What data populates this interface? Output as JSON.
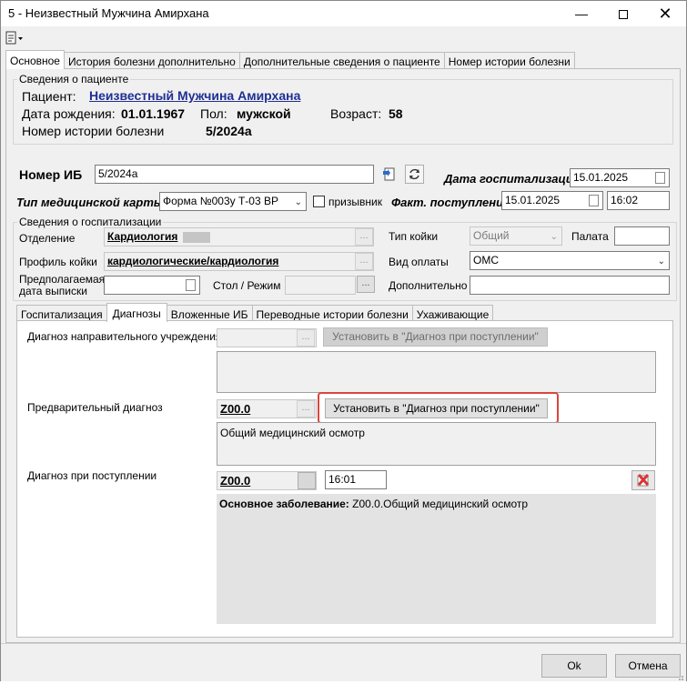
{
  "window": {
    "title": "5 - Неизвестный Мужчина Амирхана"
  },
  "top_tabs": [
    {
      "label": "Основное",
      "active": true
    },
    {
      "label": "История болезни дополнительно",
      "active": false
    },
    {
      "label": "Дополнительные сведения о пациенте",
      "active": false
    },
    {
      "label": "Номер истории болезни",
      "active": false
    }
  ],
  "patient": {
    "group_title": "Сведения о пациенте",
    "patient_label": "Пациент:",
    "patient_name": "Неизвестный Мужчина Амирхана",
    "birth_label": "Дата рождения:",
    "birth_value": "01.01.1967",
    "sex_label": "Пол:",
    "sex_value": "мужской",
    "age_label": "Возраст:",
    "age_value": "58",
    "history_label": "Номер истории болезни",
    "history_value": "5/2024а"
  },
  "ib": {
    "label": "Номер ИБ",
    "value": "5/2024а",
    "hosp_date_label": "Дата госпитализации",
    "hosp_date_value": "15.01.2025",
    "card_type_label": "Тип медицинской карты",
    "card_type_value": "Форма №003у Т-03 ВР",
    "conscript_label": "призывник",
    "admission_label": "Факт. поступление",
    "admission_date": "15.01.2025",
    "admission_time": "16:02"
  },
  "hosp": {
    "group_title": "Сведения о госпитализации",
    "dept_label": "Отделение",
    "dept_value": "Кардиология",
    "bed_type_label": "Тип койки",
    "bed_type_value": "Общий",
    "ward_label": "Палата",
    "ward_value": "",
    "profile_label": "Профиль койки",
    "profile_value": "кардиологические/кардиология",
    "payment_label": "Вид оплаты",
    "payment_value": "ОМС",
    "discharge_label_1": "Предполагаемая",
    "discharge_label_2": "дата выписки",
    "table_label": "Стол / Режим",
    "additional_label": "Дополнительно"
  },
  "inner_tabs": [
    {
      "label": "Госпитализация",
      "active": false
    },
    {
      "label": "Диагнозы",
      "active": true
    },
    {
      "label": "Вложенные ИБ",
      "active": false
    },
    {
      "label": "Переводные истории болезни",
      "active": false
    },
    {
      "label": "Ухаживающие",
      "active": false
    }
  ],
  "diagnoses": {
    "referral_label": "Диагноз направительного учреждения",
    "set_button_label": "Установить в \"Диагноз при поступлении\"",
    "preliminary_label": "Предварительный диагноз",
    "preliminary_code": "Z00.0",
    "preliminary_text": "Общий медицинский осмотр",
    "admission_label": "Диагноз при поступлении",
    "admission_code": "Z00.0",
    "admission_time": "16:01",
    "main_disease_label": "Основное заболевание:",
    "main_disease_value": "Z00.0.Общий медицинский осмотр"
  },
  "footer": {
    "ok_label": "Ok",
    "cancel_label": "Отмена"
  }
}
